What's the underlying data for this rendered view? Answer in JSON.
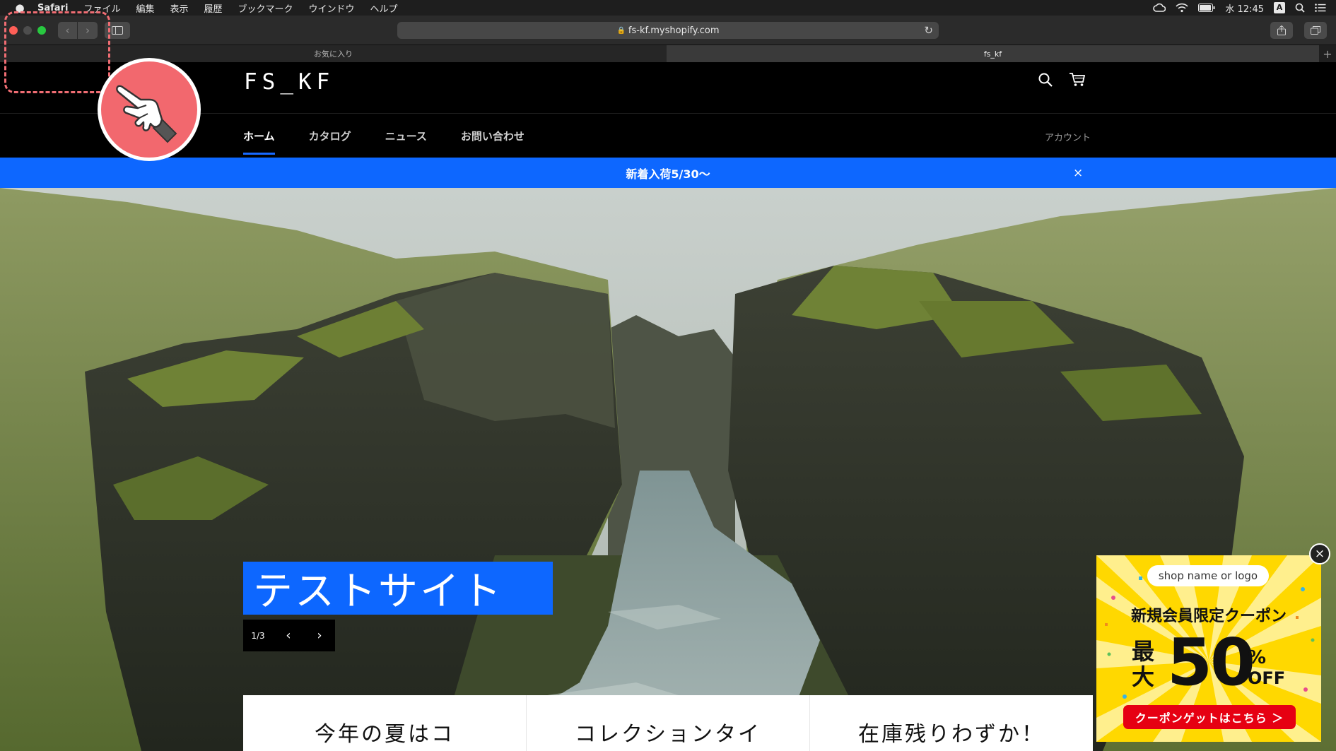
{
  "menubar": {
    "apple": "",
    "app_name": "Safari",
    "menus": [
      "ファイル",
      "編集",
      "表示",
      "履歴",
      "ブックマーク",
      "ウインドウ",
      "ヘルプ"
    ],
    "clock": "水 12:45",
    "ime": "A"
  },
  "toolbar": {
    "url": "fs-kf.myshopify.com"
  },
  "tabs": [
    {
      "label": "お気に入り"
    },
    {
      "label": "fs_kf"
    }
  ],
  "shop": {
    "logo": "FS_KF",
    "nav": [
      {
        "label": "ホーム",
        "active": true
      },
      {
        "label": "カタログ"
      },
      {
        "label": "ニュース"
      },
      {
        "label": "お問い合わせ"
      }
    ],
    "account": "アカウント"
  },
  "announcement": {
    "text": "新着入荷5/30〜",
    "close": "×"
  },
  "hero": {
    "title": "テストサイト",
    "counter": "1/3",
    "prev": "‹",
    "next": "›"
  },
  "cards": [
    {
      "title": "今年の夏はコ"
    },
    {
      "title": "コレクションタイ"
    },
    {
      "title": "在庫残りわずか！"
    }
  ],
  "coupon": {
    "shop_name": "shop name or logo",
    "heading": "新規会員限定クーポン",
    "max_label": "最大",
    "discount_number": "50",
    "percent": "%",
    "off": "OFF",
    "button": "クーポンゲットはこちら ＞",
    "close": "×"
  },
  "colors": {
    "accent_blue": "#0d67ff",
    "coupon_yellow": "#ffd800",
    "coupon_red": "#e60012",
    "overlay_pink": "#f2686e"
  }
}
